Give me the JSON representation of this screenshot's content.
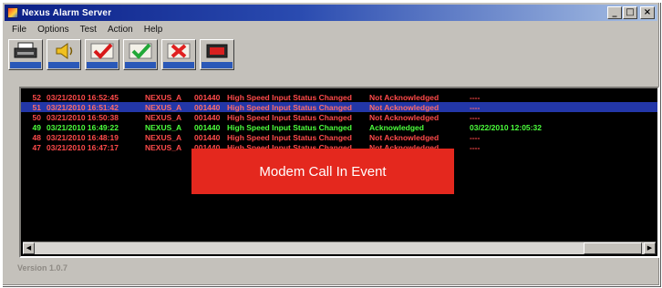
{
  "window": {
    "title": "Nexus Alarm Server",
    "title_buttons": [
      "_",
      "□",
      "×"
    ]
  },
  "menu": [
    "File",
    "Options",
    "Test",
    "Action",
    "Help"
  ],
  "toolbar": [
    {
      "name": "print",
      "icon": "printer-icon",
      "accent": "#3a3a3a"
    },
    {
      "name": "silence",
      "icon": "speaker-icon",
      "accent": "#f0c020"
    },
    {
      "name": "acknowledge",
      "icon": "red-check-icon",
      "accent": "#d81818"
    },
    {
      "name": "acknowledge-all",
      "icon": "green-check-icon",
      "accent": "#22a838"
    },
    {
      "name": "delete",
      "icon": "red-x-icon",
      "accent": "#e02020"
    },
    {
      "name": "exit",
      "icon": "exit-icon",
      "accent": "#d82020"
    }
  ],
  "log": {
    "rows": [
      {
        "idx": "52",
        "date": "03/21/2010 16:52:45",
        "node": "NEXUS_A",
        "code": "001440",
        "msg": "High Speed Input Status Changed",
        "ack": "Not Acknowledged",
        "time": "----",
        "color": "#ff4a4a",
        "selected": false
      },
      {
        "idx": "51",
        "date": "03/21/2010 16:51:42",
        "node": "NEXUS_A",
        "code": "001440",
        "msg": "High Speed Input Status Changed",
        "ack": "Not Acknowledged",
        "time": "----",
        "color": "#ff6a6a",
        "selected": true
      },
      {
        "idx": "50",
        "date": "03/21/2010 16:50:38",
        "node": "NEXUS_A",
        "code": "001440",
        "msg": "High Speed Input Status Changed",
        "ack": "Not Acknowledged",
        "time": "----",
        "color": "#ff4a4a",
        "selected": false
      },
      {
        "idx": "49",
        "date": "03/21/2010 16:49:22",
        "node": "NEXUS_A",
        "code": "001440",
        "msg": "High Speed Input Status Changed",
        "ack": "Acknowledged",
        "time": "03/22/2010 12:05:32",
        "color": "#4cff3c",
        "selected": false
      },
      {
        "idx": "48",
        "date": "03/21/2010 16:48:19",
        "node": "NEXUS_A",
        "code": "001440",
        "msg": "High Speed Input Status Changed",
        "ack": "Not Acknowledged",
        "time": "----",
        "color": "#ff4a4a",
        "selected": false
      },
      {
        "idx": "47",
        "date": "03/21/2010 16:47:17",
        "node": "NEXUS_A",
        "code": "001440",
        "msg": "High Speed Input Status Changed",
        "ack": "Not Acknowledged",
        "time": "----",
        "color": "#ff4a4a",
        "selected": false
      }
    ]
  },
  "scroll": {
    "left_arrow": "◀",
    "right_arrow": "▶"
  },
  "status": {
    "version": "Version 1.0.7"
  },
  "banner": {
    "text": "Modem Call In Event"
  }
}
